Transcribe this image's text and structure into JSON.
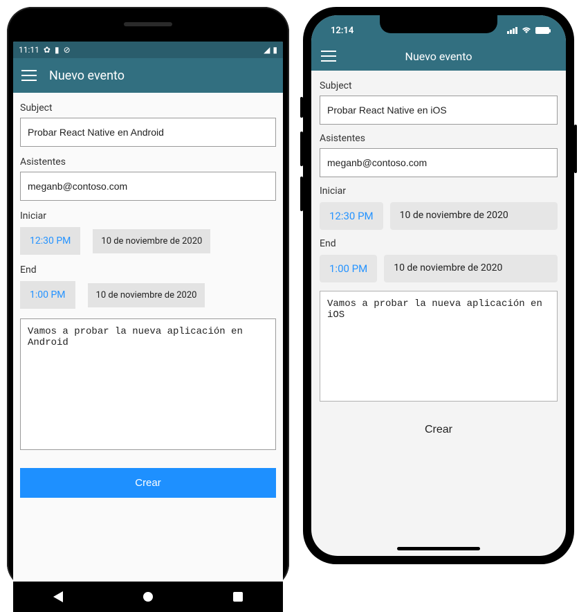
{
  "android": {
    "status": {
      "time": "11:11",
      "icons": [
        "gear-icon",
        "sd-icon",
        "dnd-icon"
      ],
      "right": [
        "signal-icon",
        "battery-icon"
      ]
    },
    "appbar": {
      "title": "Nuevo evento"
    },
    "form": {
      "subject_label": "Subject",
      "subject_value": "Probar React Native en Android",
      "attendees_label": "Asistentes",
      "attendees_value": "meganb@contoso.com",
      "start_label": "Iniciar",
      "start_time": "12:30 PM",
      "start_date": "10 de noviembre de 2020",
      "end_label": "End",
      "end_time": "1:00 PM",
      "end_date": "10 de noviembre de 2020",
      "body_value": "Vamos a probar la nueva aplicación en Android",
      "create_label": "Crear"
    }
  },
  "ios": {
    "status": {
      "time": "12:14",
      "right": [
        "signal-icon",
        "wifi-icon",
        "battery-icon"
      ]
    },
    "appbar": {
      "title": "Nuevo evento"
    },
    "form": {
      "subject_label": "Subject",
      "subject_value": "Probar React Native en iOS",
      "attendees_label": "Asistentes",
      "attendees_value": "meganb@contoso.com",
      "start_label": "Iniciar",
      "start_time": "12:30 PM",
      "start_date": "10 de noviembre de 2020",
      "end_label": "End",
      "end_time": "1:00 PM",
      "end_date": "10 de noviembre de 2020",
      "body_value": "Vamos a probar la nueva aplicación en iOS",
      "create_label": "Crear"
    }
  }
}
